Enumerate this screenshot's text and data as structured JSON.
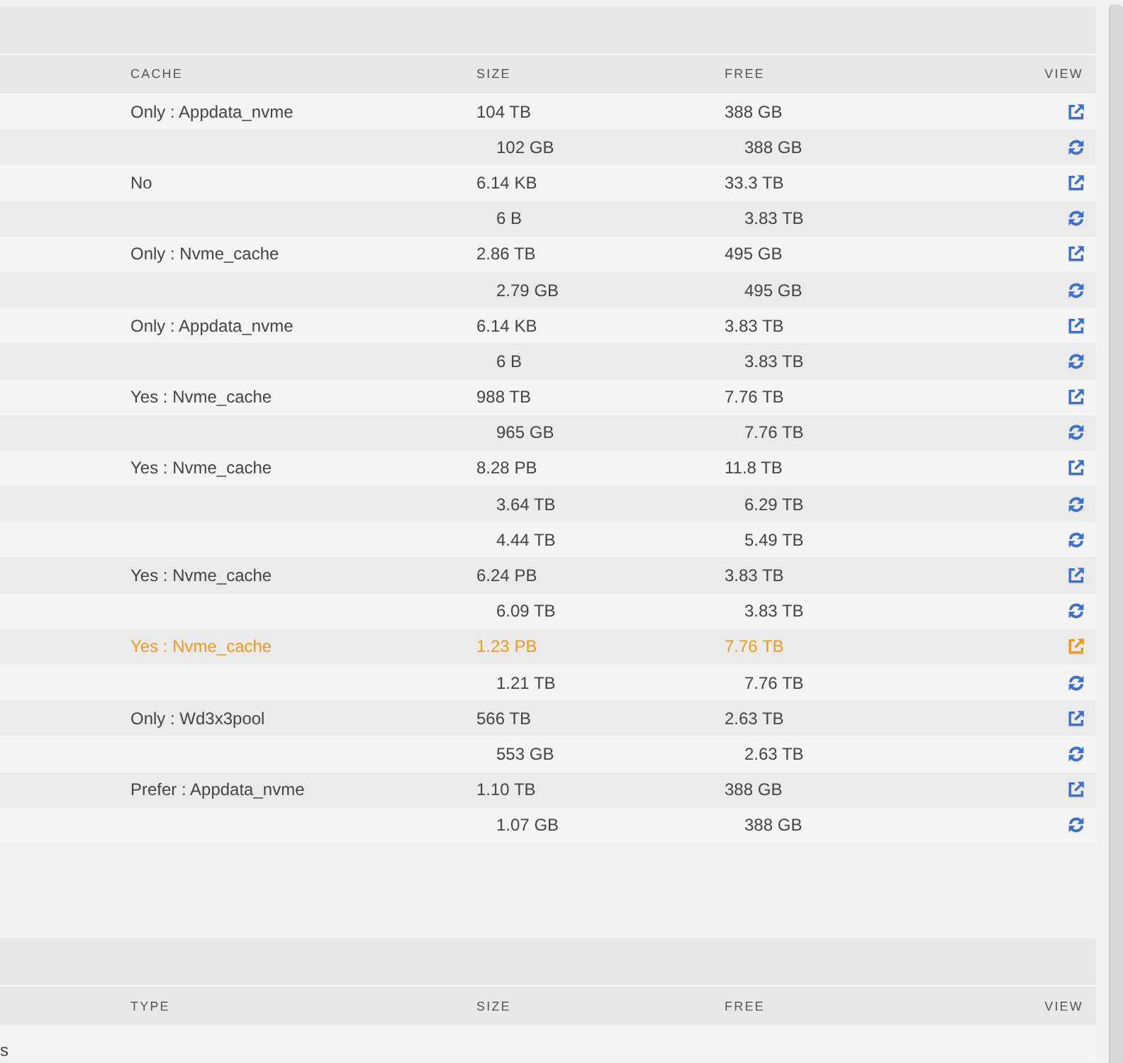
{
  "upper_table": {
    "columns": [
      "CACHE",
      "SIZE",
      "FREE",
      "VIEW"
    ],
    "rows": [
      {
        "cache": "Only : Appdata_nvme",
        "size": "104 TB",
        "free": "388 GB",
        "highlighted": false,
        "children": [
          {
            "size": "102 GB",
            "free": "388 GB",
            "highlighted": false
          }
        ]
      },
      {
        "cache": "No",
        "size": "6.14 KB",
        "free": "33.3 TB",
        "highlighted": false,
        "children": [
          {
            "size": "6 B",
            "free": "3.83 TB",
            "highlighted": false
          }
        ]
      },
      {
        "cache": "Only : Nvme_cache",
        "size": "2.86 TB",
        "free": "495 GB",
        "highlighted": false,
        "children": [
          {
            "size": "2.79 GB",
            "free": "495 GB",
            "highlighted": false
          }
        ]
      },
      {
        "cache": "Only : Appdata_nvme",
        "size": "6.14 KB",
        "free": "3.83 TB",
        "highlighted": false,
        "children": [
          {
            "size": "6 B",
            "free": "3.83 TB",
            "highlighted": false
          }
        ]
      },
      {
        "cache": "Yes : Nvme_cache",
        "size": "988 TB",
        "free": "7.76 TB",
        "highlighted": false,
        "children": [
          {
            "size": "965 GB",
            "free": "7.76 TB",
            "highlighted": false
          }
        ]
      },
      {
        "cache": "Yes : Nvme_cache",
        "size": "8.28 PB",
        "free": "11.8 TB",
        "highlighted": false,
        "children": [
          {
            "size": "3.64 TB",
            "free": "6.29 TB",
            "highlighted": false
          },
          {
            "size": "4.44 TB",
            "free": "5.49 TB",
            "highlighted": false
          }
        ]
      },
      {
        "cache": "Yes : Nvme_cache",
        "size": "6.24 PB",
        "free": "3.83 TB",
        "highlighted": false,
        "children": [
          {
            "size": "6.09 TB",
            "free": "3.83 TB",
            "highlighted": false
          }
        ]
      },
      {
        "cache": "Yes : Nvme_cache",
        "size": "1.23 PB",
        "free": "7.76 TB",
        "highlighted": true,
        "children": [
          {
            "size": "1.21 TB",
            "free": "7.76 TB",
            "highlighted": false
          }
        ]
      },
      {
        "cache": "Only : Wd3x3pool",
        "size": "566 TB",
        "free": "2.63 TB",
        "highlighted": false,
        "children": [
          {
            "size": "553 GB",
            "free": "2.63 TB",
            "highlighted": false
          }
        ]
      },
      {
        "cache": "Prefer : Appdata_nvme",
        "size": "1.10 TB",
        "free": "388 GB",
        "highlighted": false,
        "children": [
          {
            "size": "1.07 GB",
            "free": "388 GB",
            "highlighted": false
          }
        ]
      }
    ]
  },
  "lower_table": {
    "columns": [
      "TYPE",
      "SIZE",
      "FREE",
      "VIEW"
    ],
    "rows": [
      {
        "column_1": "s"
      }
    ]
  }
}
